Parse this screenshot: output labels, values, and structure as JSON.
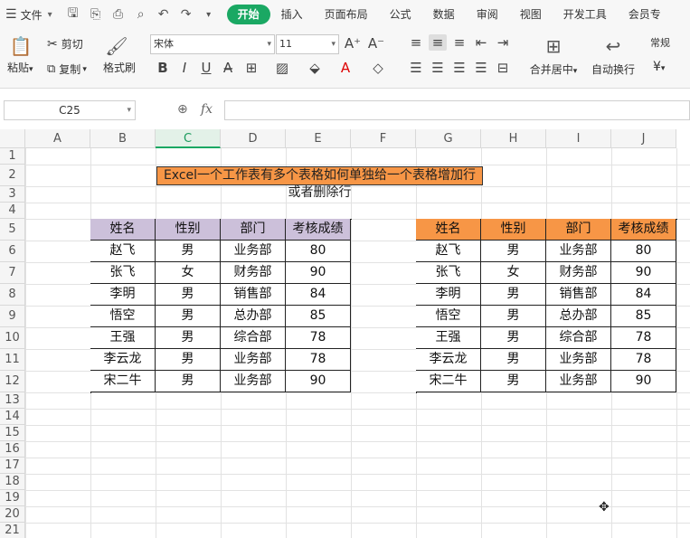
{
  "menubar": {
    "file_label": "文件",
    "tabs": [
      "开始",
      "插入",
      "页面布局",
      "公式",
      "数据",
      "审阅",
      "视图",
      "开发工具",
      "会员专"
    ]
  },
  "ribbon": {
    "paste": "粘贴",
    "cut": "剪切",
    "copy": "复制",
    "format_painter": "格式刷",
    "font_name": "宋体",
    "font_size": "11",
    "merge_center": "合并居中",
    "wrap_text": "自动换行",
    "number_format": "常规",
    "currency": "¥"
  },
  "formula_bar": {
    "name_box": "C25",
    "fx": "fx",
    "formula": ""
  },
  "sheet": {
    "columns": [
      "A",
      "B",
      "C",
      "D",
      "E",
      "F",
      "G",
      "H",
      "I",
      "J"
    ],
    "selected_column": "C",
    "rows": [
      "1",
      "2",
      "3",
      "4",
      "5",
      "6",
      "7",
      "8",
      "9",
      "10",
      "11",
      "12",
      "13",
      "14",
      "15",
      "16",
      "17",
      "18",
      "19",
      "20",
      "21"
    ],
    "title": "Excel一个工作表有多个表格如何单独给一个表格增加行或者删除行",
    "table_left": {
      "headers": [
        "姓名",
        "性别",
        "部门",
        "考核成绩"
      ],
      "rows": [
        [
          "赵飞",
          "男",
          "业务部",
          "80"
        ],
        [
          "张飞",
          "女",
          "财务部",
          "90"
        ],
        [
          "李明",
          "男",
          "销售部",
          "84"
        ],
        [
          "悟空",
          "男",
          "总办部",
          "85"
        ],
        [
          "王强",
          "男",
          "综合部",
          "78"
        ],
        [
          "李云龙",
          "男",
          "业务部",
          "78"
        ],
        [
          "宋二牛",
          "男",
          "业务部",
          "90"
        ]
      ]
    },
    "table_right": {
      "headers": [
        "姓名",
        "性别",
        "部门",
        "考核成绩"
      ],
      "rows": [
        [
          "赵飞",
          "男",
          "业务部",
          "80"
        ],
        [
          "张飞",
          "女",
          "财务部",
          "90"
        ],
        [
          "李明",
          "男",
          "销售部",
          "84"
        ],
        [
          "悟空",
          "男",
          "总办部",
          "85"
        ],
        [
          "王强",
          "男",
          "综合部",
          "78"
        ],
        [
          "李云龙",
          "男",
          "业务部",
          "78"
        ],
        [
          "宋二牛",
          "男",
          "业务部",
          "90"
        ]
      ]
    },
    "colors": {
      "left_header": "#ccc0da",
      "right_header": "#f79646",
      "title_fill": "#f79646",
      "accent": "#1aa863"
    }
  }
}
